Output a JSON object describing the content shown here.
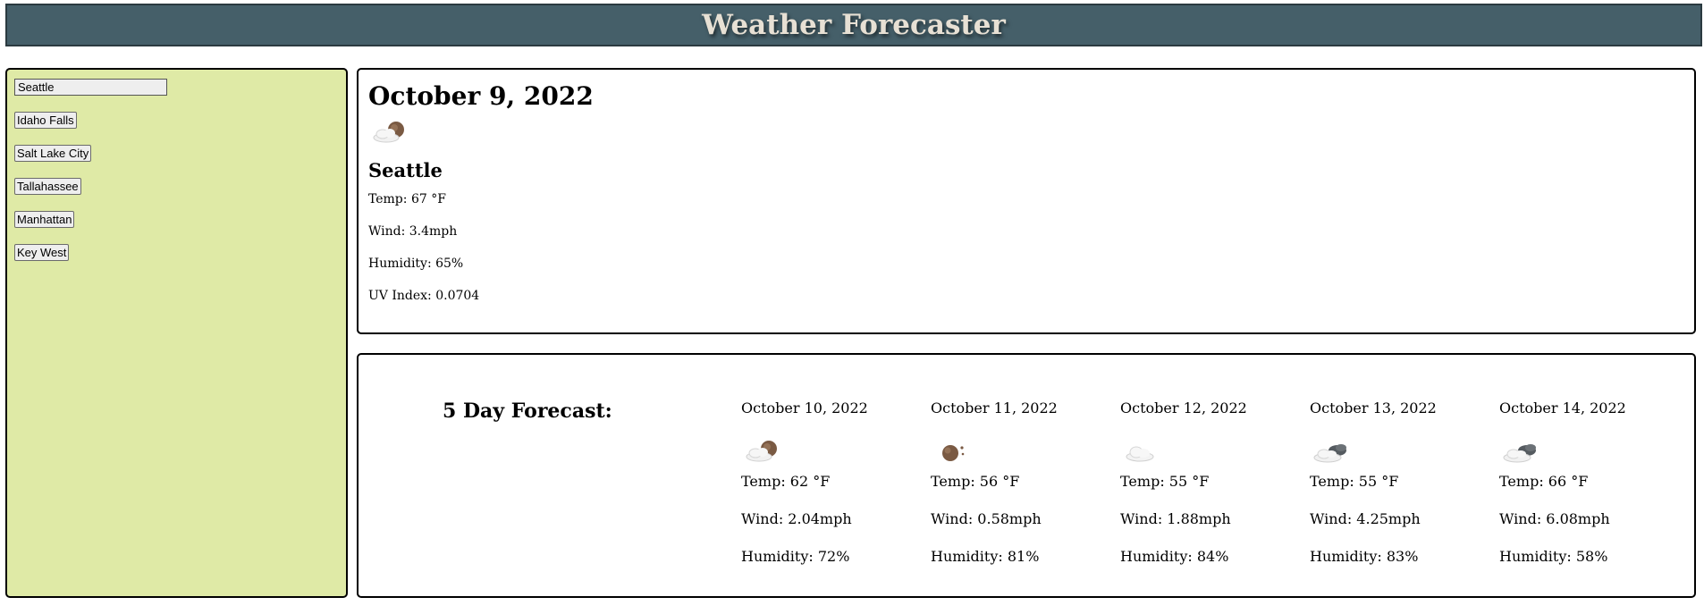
{
  "header": {
    "title": "Weather Forecaster"
  },
  "sidebar": {
    "search_value": "Seattle",
    "cities": [
      "Idaho Falls",
      "Salt Lake City",
      "Tallahassee",
      "Manhattan",
      "Key West"
    ]
  },
  "current": {
    "date": "October 9, 2022",
    "icon": "partly-cloudy-night-icon",
    "city": "Seattle",
    "temp": "Temp: 67 °F",
    "wind": "Wind: 3.4mph",
    "humidity": "Humidity: 65%",
    "uv": "UV Index: 0.0704"
  },
  "forecast": {
    "title": "5 Day Forecast:",
    "days": [
      {
        "date": "October 10, 2022",
        "icon": "partly-cloudy-night-icon",
        "temp": "Temp: 62 °F",
        "wind": "Wind: 2.04mph",
        "humidity": "Humidity: 72%"
      },
      {
        "date": "October 11, 2022",
        "icon": "clear-night-icon",
        "temp": "Temp: 56 °F",
        "wind": "Wind: 0.58mph",
        "humidity": "Humidity: 81%"
      },
      {
        "date": "October 12, 2022",
        "icon": "cloud-icon",
        "temp": "Temp: 55 °F",
        "wind": "Wind: 1.88mph",
        "humidity": "Humidity: 84%"
      },
      {
        "date": "October 13, 2022",
        "icon": "broken-clouds-icon",
        "temp": "Temp: 55 °F",
        "wind": "Wind: 4.25mph",
        "humidity": "Humidity: 83%"
      },
      {
        "date": "October 14, 2022",
        "icon": "broken-clouds-icon",
        "temp": "Temp: 66 °F",
        "wind": "Wind: 6.08mph",
        "humidity": "Humidity: 58%"
      }
    ]
  },
  "colors": {
    "header_bg": "#455f69",
    "header_text": "#e7e0d4",
    "sidebar_bg": "#dfeaa6"
  }
}
